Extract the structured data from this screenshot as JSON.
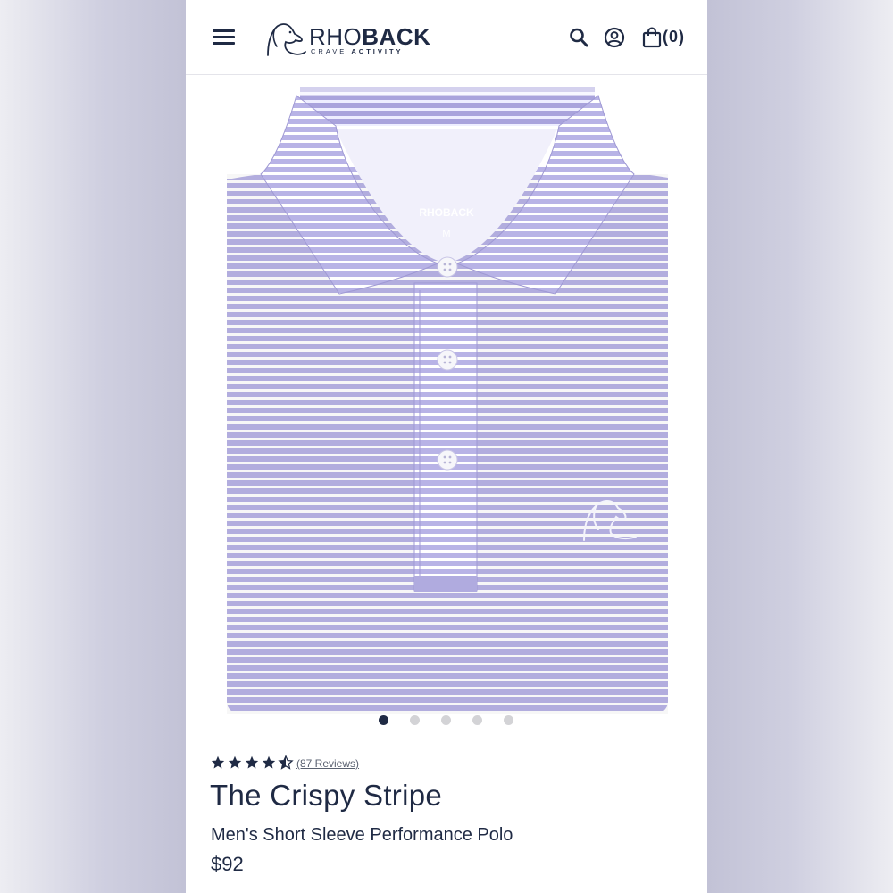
{
  "header": {
    "menu_icon": "hamburger-menu-icon",
    "logo": {
      "word_light": "RHO",
      "word_bold": "BACK",
      "tag_light": "CRAVE ",
      "tag_bold": "ACTIVITY"
    },
    "search_icon": "search-icon",
    "account_icon": "account-icon",
    "cart_icon": "shopping-bag-icon",
    "cart_count": "(0)"
  },
  "gallery": {
    "shirt_color": "#b8b3e6",
    "stripe_color": "#ffffff",
    "collar_label": "RHOBACK",
    "size_label": "M",
    "slide_count": 5,
    "active_slide": 1
  },
  "product": {
    "rating": 4.5,
    "reviews": "(87 Reviews)",
    "title": "The Crispy Stripe",
    "subtitle": "Men's Short Sleeve Performance Polo",
    "price": "$92"
  },
  "colors": {
    "navy": "#1f2a44",
    "dot_inactive": "#d3d3d6"
  }
}
